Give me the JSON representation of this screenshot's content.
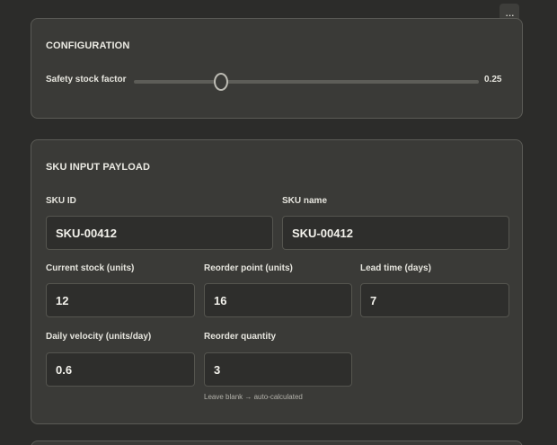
{
  "menu": {
    "more_label": "···"
  },
  "configuration": {
    "title": "CONFIGURATION",
    "slider": {
      "label": "Safety stock factor",
      "value": 0.25,
      "value_text": "0.25",
      "min": 0,
      "max": 1
    }
  },
  "sku": {
    "title": "SKU INPUT PAYLOAD",
    "fields": {
      "sku_id": {
        "label": "SKU ID",
        "value": "SKU-00412"
      },
      "sku_name": {
        "label": "SKU name",
        "value": "SKU-00412"
      },
      "current_stock": {
        "label": "Current stock (units)",
        "value": "12"
      },
      "reorder_point": {
        "label": "Reorder point (units)",
        "value": "16"
      },
      "lead_time": {
        "label": "Lead time (days)",
        "value": "7"
      },
      "daily_velocity": {
        "label": "Daily velocity (units/day)",
        "value": "0.6"
      },
      "reorder_quantity": {
        "label": "Reorder quantity",
        "value": "3",
        "helper": "Leave blank → auto-calculated"
      }
    }
  },
  "colors": {
    "background": "#2c2c2a",
    "panel": "#3a3a37",
    "border": "#5b5b56",
    "input_bg": "#2e2e2c",
    "text": "#ecebe4"
  }
}
